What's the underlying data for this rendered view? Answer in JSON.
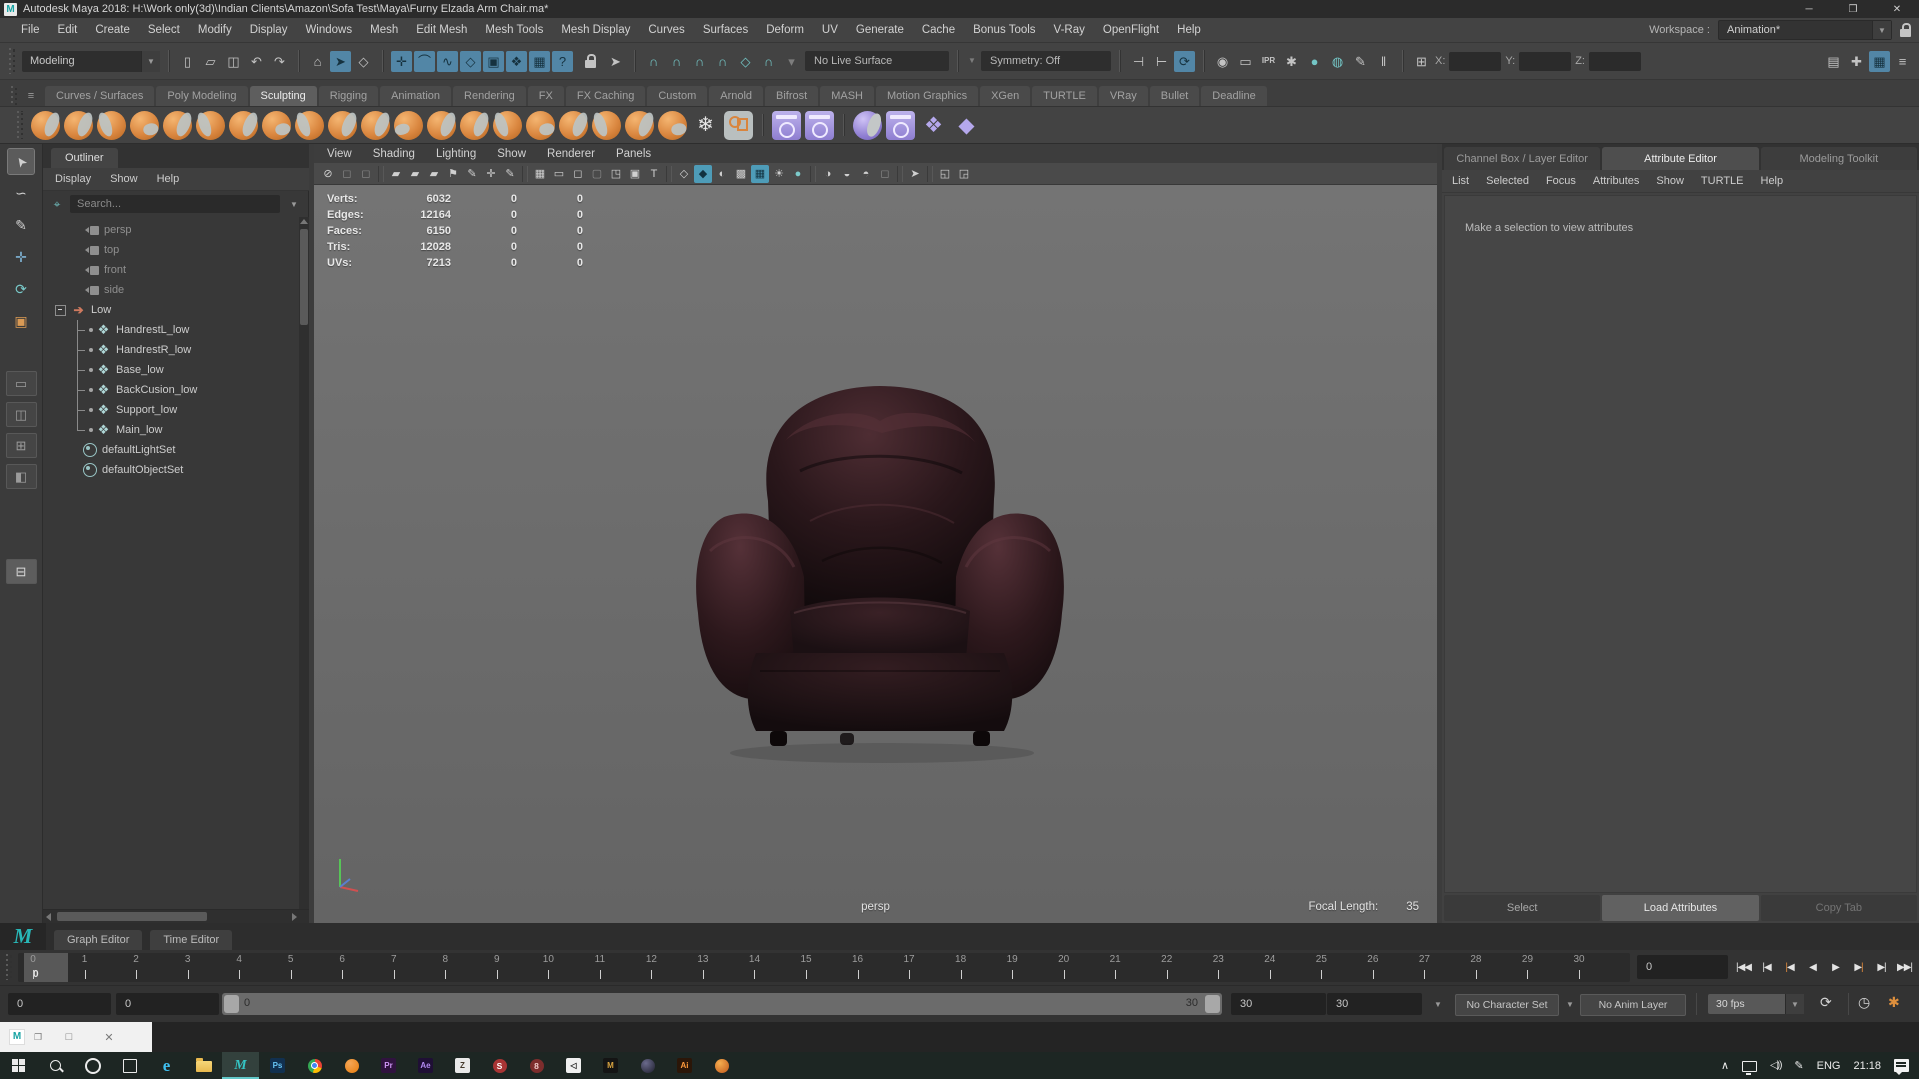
{
  "window": {
    "title": "Autodesk Maya 2018: H:\\Work only(3d)\\Indian Clients\\Amazon\\Sofa Test\\Maya\\Furny Elzada Arm Chair.ma*",
    "controls": [
      {
        "name": "minimize",
        "glyph": "─"
      },
      {
        "name": "maximize",
        "glyph": "❒"
      },
      {
        "name": "close",
        "glyph": "✕"
      }
    ]
  },
  "menubar": {
    "items": [
      "File",
      "Edit",
      "Create",
      "Select",
      "Modify",
      "Display",
      "Windows",
      "Mesh",
      "Edit Mesh",
      "Mesh Tools",
      "Mesh Display",
      "Curves",
      "Surfaces",
      "Deform",
      "UV",
      "Generate",
      "Cache",
      "Bonus Tools",
      "V-Ray",
      "OpenFlight",
      "Help"
    ],
    "workspace_label": "Workspace :",
    "workspace_value": "Animation*"
  },
  "statusline": {
    "mode": "Modeling",
    "no_live_surface": "No Live Surface",
    "symmetry": "Symmetry: Off",
    "x_label": "X:",
    "y_label": "Y:",
    "z_label": "Z:",
    "groups": {
      "file": [
        {
          "n": "new-scene-icon",
          "g": "▯"
        },
        {
          "n": "open-scene-icon",
          "g": "▱"
        },
        {
          "n": "save-scene-icon",
          "g": "◫"
        },
        {
          "n": "undo-icon",
          "g": "↶"
        },
        {
          "n": "redo-icon",
          "g": "↷"
        }
      ],
      "select": [
        {
          "n": "select-hierarchy-icon",
          "g": "⌂"
        },
        {
          "n": "select-object-icon",
          "g": "➤",
          "hl": true
        },
        {
          "n": "select-component-icon",
          "g": "◇"
        }
      ],
      "masks": [
        {
          "n": "mask-points-icon",
          "g": "✛",
          "hl": true
        },
        {
          "n": "mask-handles-icon",
          "g": "⌒",
          "hl": true
        },
        {
          "n": "mask-curves-icon",
          "g": "∿",
          "hl": true
        },
        {
          "n": "mask-surfaces-icon",
          "g": "◇",
          "hl": true
        },
        {
          "n": "mask-deformations-icon",
          "g": "▣",
          "hl": true
        },
        {
          "n": "mask-dynamics-icon",
          "g": "❖",
          "hl": true
        },
        {
          "n": "mask-rendering-icon",
          "g": "▦",
          "hl": true
        },
        {
          "n": "mask-misc-icon",
          "g": "?",
          "hl": true
        }
      ],
      "locks": [
        {
          "n": "lock-selection-icon",
          "kind": "lock"
        },
        {
          "n": "select-through-icon",
          "g": "➤"
        }
      ],
      "snaps": [
        {
          "n": "snap-grid-icon",
          "g": "∩",
          "teal": true
        },
        {
          "n": "snap-curve-icon",
          "g": "∩",
          "teal": true
        },
        {
          "n": "snap-point-icon",
          "g": "∩",
          "teal": true
        },
        {
          "n": "snap-center-icon",
          "g": "∩",
          "teal": true
        },
        {
          "n": "snap-plane-icon",
          "g": "◇",
          "teal": true
        },
        {
          "n": "snap-live-icon",
          "g": "∩",
          "teal": true
        },
        {
          "n": "snap-more-icon",
          "g": "▾",
          "dim": true
        }
      ],
      "history": [
        {
          "n": "input-connections-icon",
          "g": "⊣"
        },
        {
          "n": "output-connections-icon",
          "g": "⊢"
        },
        {
          "n": "construction-history-icon",
          "g": "⟳",
          "hl": true
        }
      ],
      "render": [
        {
          "n": "render-view-icon",
          "g": "◉"
        },
        {
          "n": "render-frame-icon",
          "g": "▭"
        },
        {
          "n": "ipr-render-icon",
          "g": "IPR",
          "txt": true
        },
        {
          "n": "render-settings-icon",
          "g": "✱"
        },
        {
          "n": "launch-render-icon",
          "g": "●",
          "teal": true
        },
        {
          "n": "hypershade-icon",
          "g": "◍",
          "teal": true
        },
        {
          "n": "paint-effects-icon",
          "g": "✎"
        },
        {
          "n": "pause-viewport-icon",
          "g": "‖"
        }
      ],
      "coords": [
        {
          "n": "absolute-relative-icon",
          "g": "⊞"
        }
      ],
      "sidebar": [
        {
          "n": "modeling-toolkit-toggle-icon",
          "g": "▤"
        },
        {
          "n": "humanik-toggle-icon",
          "g": "✚"
        },
        {
          "n": "attribute-editor-toggle-icon",
          "g": "▦",
          "hl": true
        },
        {
          "n": "channel-box-toggle-icon",
          "g": "≡"
        }
      ]
    }
  },
  "shelf": {
    "tabs": [
      "Curves / Surfaces",
      "Poly Modeling",
      "Sculpting",
      "Rigging",
      "Animation",
      "Rendering",
      "FX",
      "FX Caching",
      "Custom",
      "Arnold",
      "Bifrost",
      "MASH",
      "Motion Graphics",
      "XGen",
      "TURTLE",
      "VRay",
      "Bullet",
      "Deadline"
    ],
    "active_tab": "Sculpting",
    "icons": [
      {
        "n": "sculpt-lift-icon",
        "t": "o"
      },
      {
        "n": "sculpt-sculpt-icon",
        "t": "o"
      },
      {
        "n": "sculpt-smooth-icon",
        "t": "o"
      },
      {
        "n": "sculpt-relax-icon",
        "t": "o"
      },
      {
        "n": "sculpt-grab-icon",
        "t": "o"
      },
      {
        "n": "sculpt-pinch-icon",
        "t": "o"
      },
      {
        "n": "sculpt-flatten-icon",
        "t": "o"
      },
      {
        "n": "sculpt-foamy-icon",
        "t": "o"
      },
      {
        "n": "sculpt-spray-icon",
        "t": "o"
      },
      {
        "n": "sculpt-repeat-icon",
        "t": "o"
      },
      {
        "n": "sculpt-imprint-icon",
        "t": "o"
      },
      {
        "n": "sculpt-wax-icon",
        "t": "o"
      },
      {
        "n": "sculpt-scrape-icon",
        "t": "o"
      },
      {
        "n": "sculpt-fill-icon",
        "t": "o"
      },
      {
        "n": "sculpt-knife-icon",
        "t": "o"
      },
      {
        "n": "sculpt-smear-icon",
        "t": "o"
      },
      {
        "n": "sculpt-bulge-icon",
        "t": "o"
      },
      {
        "n": "sculpt-amplify-icon",
        "t": "o"
      },
      {
        "n": "sculpt-spike-icon",
        "t": "o"
      },
      {
        "n": "sculpt-freeze-icon",
        "t": "o"
      },
      {
        "n": "freeze-selection-icon",
        "t": "flake",
        "g": "❄"
      },
      {
        "n": "sculpt-panel-icon",
        "t": "gray"
      },
      {
        "t": "sep"
      },
      {
        "n": "shape-editor-icon",
        "t": "pwin"
      },
      {
        "n": "pose-editor-icon",
        "t": "pwin"
      },
      {
        "t": "sep"
      },
      {
        "n": "sculpt-target-icon",
        "t": "pcirc"
      },
      {
        "n": "clone-target-icon",
        "t": "pwin"
      },
      {
        "n": "blendshape-icon",
        "t": "pdia",
        "g": "❖"
      },
      {
        "n": "bake-deform-icon",
        "t": "pdia",
        "g": "◆"
      }
    ]
  },
  "toolbox": {
    "tools": [
      {
        "n": "select-tool",
        "g": "➤",
        "cursor": true,
        "active": true
      },
      {
        "n": "lasso-tool",
        "g": "∽"
      },
      {
        "n": "paint-select-tool",
        "g": "✎"
      },
      {
        "n": "move-tool",
        "g": "✛",
        "c": "#7fb3d5"
      },
      {
        "n": "rotate-tool",
        "g": "⟳",
        "c": "#79c9c9"
      },
      {
        "n": "scale-tool",
        "g": "▣",
        "c": "#d99a55"
      }
    ],
    "layouts": [
      {
        "n": "layout-single",
        "g": "▭"
      },
      {
        "n": "layout-two-pane",
        "g": "◫"
      },
      {
        "n": "layout-four-view",
        "g": "⊞"
      },
      {
        "n": "layout-persp-outliner",
        "g": "◧"
      },
      {
        "n": "layout-current",
        "g": "⊟",
        "active": true,
        "gap": true
      }
    ]
  },
  "outliner": {
    "title": "Outliner",
    "menus": [
      "Display",
      "Show",
      "Help"
    ],
    "search_placeholder": "Search...",
    "items": [
      {
        "label": "persp",
        "icon": "camera",
        "dim": true
      },
      {
        "label": "top",
        "icon": "camera",
        "dim": true
      },
      {
        "label": "front",
        "icon": "camera",
        "dim": true
      },
      {
        "label": "side",
        "icon": "camera",
        "dim": true
      },
      {
        "label": "Low",
        "icon": "transform",
        "expanded": true
      },
      {
        "label": "HandrestL_low",
        "icon": "mesh",
        "child": true
      },
      {
        "label": "HandrestR_low",
        "icon": "mesh",
        "child": true
      },
      {
        "label": "Base_low",
        "icon": "mesh",
        "child": true
      },
      {
        "label": "BackCusion_low",
        "icon": "mesh",
        "child": true
      },
      {
        "label": "Support_low",
        "icon": "mesh",
        "child": true
      },
      {
        "label": "Main_low",
        "icon": "mesh",
        "child": true,
        "last": true
      },
      {
        "label": "defaultLightSet",
        "icon": "set"
      },
      {
        "label": "defaultObjectSet",
        "icon": "set"
      }
    ]
  },
  "viewport": {
    "menus": [
      "View",
      "Shading",
      "Lighting",
      "Show",
      "Renderer",
      "Panels"
    ],
    "icons": [
      {
        "n": "no-manipulator-icon",
        "g": "⊘"
      },
      {
        "n": "dim-toggle-a-icon",
        "g": "◻",
        "dim": true
      },
      {
        "n": "dim-toggle-b-icon",
        "g": "◻",
        "dim": true
      },
      {
        "sep": true
      },
      {
        "n": "select-camera-icon",
        "g": "▰"
      },
      {
        "n": "lock-camera-icon",
        "g": "▰"
      },
      {
        "n": "camera-attributes-icon",
        "g": "▰"
      },
      {
        "n": "bookmark-icon",
        "g": "⚑"
      },
      {
        "n": "grease-pencil-icon",
        "g": "✎"
      },
      {
        "n": "move-manip-icon",
        "g": "✛"
      },
      {
        "n": "annotate-icon",
        "g": "✎"
      },
      {
        "sep": true
      },
      {
        "n": "grid-icon",
        "g": "▦"
      },
      {
        "n": "film-gate-icon",
        "g": "▭"
      },
      {
        "n": "resolution-gate-icon",
        "g": "◻"
      },
      {
        "n": "gate-mask-icon",
        "g": "▢",
        "dim": true
      },
      {
        "n": "safe-region-icon",
        "g": "◳"
      },
      {
        "n": "image-plane-icon",
        "g": "▣"
      },
      {
        "n": "hud-text-icon",
        "g": "T"
      },
      {
        "sep": true
      },
      {
        "n": "wireframe-icon",
        "g": "◇"
      },
      {
        "n": "shaded-mode-icon",
        "g": "◆",
        "hl": true
      },
      {
        "n": "xray-icon",
        "g": "◐"
      },
      {
        "n": "textured-icon",
        "g": "▩"
      },
      {
        "n": "textured-checker-icon",
        "g": "▦",
        "hl": true
      },
      {
        "n": "lights-icon",
        "g": "☀"
      },
      {
        "n": "material-icon",
        "g": "●",
        "teal": true
      },
      {
        "sep": true
      },
      {
        "n": "shadows-icon",
        "g": "◑"
      },
      {
        "n": "occlusion-icon",
        "g": "◒"
      },
      {
        "n": "motion-blur-icon",
        "g": "◓"
      },
      {
        "n": "dim-toggle-c-icon",
        "g": "◻",
        "dim": true
      },
      {
        "sep": true
      },
      {
        "n": "isolate-select-icon",
        "g": "➤"
      },
      {
        "sep": true
      },
      {
        "n": "pane-a-icon",
        "g": "◱"
      },
      {
        "n": "pane-b-icon",
        "g": "◲"
      }
    ],
    "stats": {
      "rows": [
        {
          "label": "Verts:",
          "value": "6032",
          "a": "0",
          "b": "0"
        },
        {
          "label": "Edges:",
          "value": "12164",
          "a": "0",
          "b": "0"
        },
        {
          "label": "Faces:",
          "value": "6150",
          "a": "0",
          "b": "0"
        },
        {
          "label": "Tris:",
          "value": "12028",
          "a": "0",
          "b": "0"
        },
        {
          "label": "UVs:",
          "value": "7213",
          "a": "0",
          "b": "0"
        }
      ]
    },
    "scene_object": "dark-brown leather armchair",
    "camera_label": "persp",
    "focal_length_label": "Focal Length:",
    "focal_length_value": "35"
  },
  "attribute_editor": {
    "tabs": [
      {
        "label": "Channel Box / Layer Editor",
        "active": false
      },
      {
        "label": "Attribute Editor",
        "active": true
      },
      {
        "label": "Modeling Toolkit",
        "active": false
      }
    ],
    "menus": [
      "List",
      "Selected",
      "Focus",
      "Attributes",
      "Show",
      "TURTLE",
      "Help"
    ],
    "message": "Make a selection to view attributes",
    "buttons": [
      {
        "label": "Select"
      },
      {
        "label": "Load Attributes",
        "active": true
      },
      {
        "label": "Copy Tab",
        "dim": true
      }
    ]
  },
  "anim_panel": {
    "tabs": [
      "Graph Editor",
      "Time Editor"
    ]
  },
  "timeline": {
    "start": 0,
    "end": 30,
    "current": 0,
    "current_label": "0",
    "current_time_field": "0"
  },
  "playback": {
    "buttons": [
      {
        "n": "go-to-start-button",
        "g": "|◀◀"
      },
      {
        "n": "step-back-frame-button",
        "g": "|◀"
      },
      {
        "n": "step-back-key-button",
        "g": "|◀",
        "accent": true
      },
      {
        "n": "play-backwards-button",
        "g": "◀"
      },
      {
        "n": "play-forwards-button",
        "g": "▶"
      },
      {
        "n": "step-forward-key-button",
        "g": "▶|",
        "accent": true
      },
      {
        "n": "step-forward-frame-button",
        "g": "▶|"
      },
      {
        "n": "go-to-end-button",
        "g": "▶▶|"
      }
    ]
  },
  "range_slider": {
    "animation_start": "0",
    "playback_start": "0",
    "range_start_label": "0",
    "range_end_label": "30",
    "playback_end": "30",
    "animation_end": "30",
    "character_set": "No Character Set",
    "anim_layer": "No Anim Layer",
    "fps": "30 fps"
  },
  "floating_bar": {
    "controls": [
      {
        "name": "restore",
        "glyph": "❐"
      },
      {
        "name": "maximize",
        "glyph": "□"
      },
      {
        "name": "close",
        "glyph": "✕"
      }
    ]
  },
  "taskbar": {
    "apps": [
      {
        "n": "start-button",
        "kind": "win"
      },
      {
        "n": "search-button",
        "kind": "search"
      },
      {
        "n": "cortana-button",
        "kind": "ring"
      },
      {
        "n": "task-view-button",
        "kind": "taskview"
      },
      {
        "n": "edge-icon",
        "kind": "glyph",
        "g": "e",
        "cls": "ic-edge"
      },
      {
        "n": "file-explorer-icon",
        "kind": "folder"
      },
      {
        "n": "maya-icon",
        "kind": "glyph",
        "g": "M",
        "cls": "ic-maya",
        "active": true
      },
      {
        "n": "photoshop-icon",
        "kind": "box",
        "g": "Ps",
        "bg": "#11304f",
        "c": "#66c5f5"
      },
      {
        "n": "chrome-icon",
        "kind": "chrome"
      },
      {
        "n": "blender-icon",
        "kind": "sphere",
        "bg": "radial-gradient(circle at 35% 30%,#f5a656,#e87d0d)"
      },
      {
        "n": "premiere-icon",
        "kind": "box",
        "g": "Pr",
        "bg": "#30123f",
        "c": "#cf96f5"
      },
      {
        "n": "after-effects-icon",
        "kind": "box",
        "g": "Ae",
        "bg": "#1f0f35",
        "c": "#b28af0"
      },
      {
        "n": "zbrush-icon",
        "kind": "box",
        "g": "Z",
        "bg": "#e9e9e9",
        "c": "#44382b"
      },
      {
        "n": "substance-icon",
        "kind": "round",
        "g": "S",
        "bg": "#a83434",
        "c": "#ffffff"
      },
      {
        "n": "red-app-icon",
        "kind": "round",
        "g": "8",
        "bg": "#7d2d2d",
        "c": "#f0caca"
      },
      {
        "n": "quixel-icon",
        "kind": "box",
        "g": "◁",
        "bg": "#f0f0f0",
        "c": "#222222"
      },
      {
        "n": "marmoset-icon",
        "kind": "box",
        "g": "M",
        "bg": "#141414",
        "c": "#d9a441"
      },
      {
        "n": "dark-sphere-app-icon",
        "kind": "sphere",
        "bg": "radial-gradient(circle at 35% 30%,#6a6a8c,#1e1e2c)"
      },
      {
        "n": "illustrator-icon",
        "kind": "box",
        "g": "Ai",
        "bg": "#2b1608",
        "c": "#ff9a3c"
      },
      {
        "n": "orange-sphere-app-icon",
        "kind": "sphere",
        "bg": "radial-gradient(circle at 35% 30%,#f5ad4f,#c2591b)"
      }
    ],
    "tray": {
      "language": "ENG",
      "time": "21:18"
    }
  },
  "colors": {
    "accent_teal": "#35c4c4",
    "highlight_blue": "#5286a6",
    "viewport_gray": "#6b6b6b",
    "shelf_orange": "#da8740",
    "shelf_purple": "#a99ce2",
    "key_orange": "#e08a3c",
    "chair_leather_dark": "#140b0d",
    "chair_le ather_highlight": "#4e2d33"
  }
}
